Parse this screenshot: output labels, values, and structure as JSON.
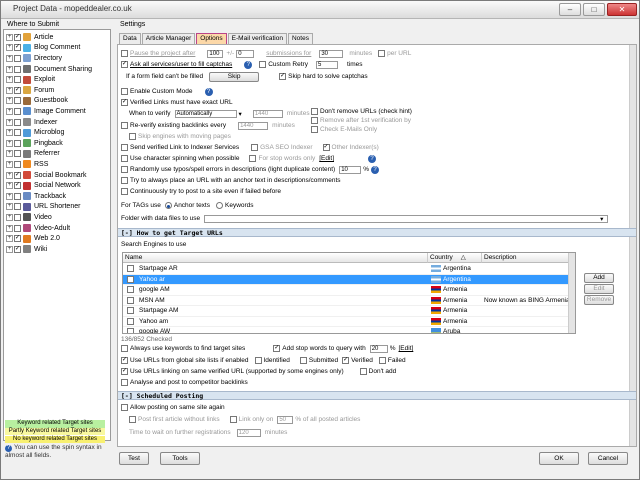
{
  "window": {
    "title": "Project Data - mopeddealer.co.uk"
  },
  "left": {
    "legend": "Where to Submit",
    "items": [
      {
        "label": "Article",
        "checked": true,
        "color": "#e2a23a",
        "sel": false
      },
      {
        "label": "Blog Comment",
        "checked": true,
        "color": "#4ab0e6",
        "sel": false
      },
      {
        "label": "Directory",
        "checked": false,
        "color": "#7c9fd0",
        "sel": false
      },
      {
        "label": "Document Sharing",
        "checked": false,
        "color": "#6f6f6f",
        "sel": false
      },
      {
        "label": "Exploit",
        "checked": false,
        "color": "#c24b3a",
        "sel": false
      },
      {
        "label": "Forum",
        "checked": true,
        "color": "#d9a640",
        "sel": false
      },
      {
        "label": "Guestbook",
        "checked": false,
        "color": "#9a6a3a",
        "sel": false
      },
      {
        "label": "Image Comment",
        "checked": false,
        "color": "#5a8fcf",
        "sel": false
      },
      {
        "label": "Indexer",
        "checked": false,
        "color": "#8a8a8a",
        "sel": false
      },
      {
        "label": "Microblog",
        "checked": false,
        "color": "#4f9bd9",
        "sel": false
      },
      {
        "label": "Pingback",
        "checked": false,
        "color": "#5ba35b",
        "sel": false
      },
      {
        "label": "Referrer",
        "checked": false,
        "color": "#7a7a7a",
        "sel": false
      },
      {
        "label": "RSS",
        "checked": false,
        "color": "#f08a20",
        "sel": false
      },
      {
        "label": "Social Bookmark",
        "checked": true,
        "color": "#d24a3a",
        "sel": false
      },
      {
        "label": "Social Network",
        "checked": true,
        "color": "#c23030",
        "sel": false
      },
      {
        "label": "Trackback",
        "checked": false,
        "color": "#6a8cc4",
        "sel": false
      },
      {
        "label": "URL Shortener",
        "checked": false,
        "color": "#5a5a9a",
        "sel": false
      },
      {
        "label": "Video",
        "checked": false,
        "color": "#555555",
        "sel": false
      },
      {
        "label": "Video-Adult",
        "checked": false,
        "color": "#b04a7a",
        "sel": false
      },
      {
        "label": "Web 2.0",
        "checked": true,
        "color": "#e07a20",
        "sel": false
      },
      {
        "label": "Wiki",
        "checked": true,
        "color": "#808080",
        "sel": false
      }
    ],
    "legend_keys": [
      {
        "label": "Keyword related Target sites",
        "color": "#b8f0a0"
      },
      {
        "label": "Partly Keyword related Target sites",
        "color": "#f8f8a0"
      },
      {
        "label": "No keyword related Target sites",
        "color": "#f8f070"
      }
    ],
    "hint": "You can use the spin syntax in almost all fields."
  },
  "settings": {
    "legend": "Settings",
    "tabs": [
      "Data",
      "Article Manager",
      "Options",
      "E-Mail verification",
      "Notes"
    ],
    "active_tab": 2,
    "pause_label": "Pause the project after",
    "pause_value": "100",
    "pm_label": "+/-",
    "pm_value": "0",
    "pause_unit": "submissions for",
    "minutes_value": "30",
    "minutes_label": "minutes",
    "per_url": "per URL",
    "ask_all": "Ask all services/user to fill captchas",
    "custom_retry": "Custom Retry",
    "retry_value": "5",
    "times": "times",
    "form_fail": "If a form field can't be filled",
    "skip_value": "Skip",
    "skip_hard": "Skip hard to solve captchas",
    "custom_mode": "Enable Custom Mode",
    "verified_links": "Verified Links must have exact URL",
    "when_verify": "When to verify",
    "verify_mode": "Automatically",
    "verify_min": "1440",
    "dont_remove": "Don't remove URLs (check hint)",
    "remove_after": "Remove after 1st verification by",
    "check_email": "Check E-Mails Only",
    "reverify": "Re-verify existing backlinks every",
    "reverify_min": "1440",
    "skip_moving": "Skip engines with moving pages",
    "send_verified": "Send verified Link to Indexer Services",
    "gsa_seo": "GSA SEO Indexer",
    "other_idx": "Other Indexer(s)",
    "char_spin": "Use character spinning when possible",
    "stop_words": "For stop words only",
    "edit": "[Edit]",
    "random_typos": "Randomly use typos/spell errors in descriptions (light duplicate content)",
    "typo_pct": "10",
    "pct": "%",
    "try_place": "Try to always place an URL with an anchor text in descriptions/comments",
    "continuously": "Continuously try to post to a site even if failed before",
    "tags_label": "For TAGs use",
    "anchor_texts": "Anchor texts",
    "keywords": "Keywords",
    "folder_label": "Folder with  data files to use",
    "sec1": "[-] How to get Target URLs",
    "search_label": "Search Engines to use",
    "cols": [
      "Name",
      "Country",
      "Description"
    ],
    "rows": [
      {
        "name": "Startpage AR",
        "country": "Argentina",
        "desc": "",
        "sel": false,
        "flag": "ar"
      },
      {
        "name": "Yahoo ar",
        "country": "Argentina",
        "desc": "",
        "sel": true,
        "flag": "ar"
      },
      {
        "name": "google AM",
        "country": "Armenia",
        "desc": "",
        "sel": false,
        "flag": "am"
      },
      {
        "name": "MSN AM",
        "country": "Armenia",
        "desc": "Now known as BING Armenia",
        "sel": false,
        "flag": "am"
      },
      {
        "name": "Startpage AM",
        "country": "Armenia",
        "desc": "",
        "sel": false,
        "flag": "am"
      },
      {
        "name": "Yahoo am",
        "country": "Armenia",
        "desc": "",
        "sel": false,
        "flag": "am"
      },
      {
        "name": "google AW",
        "country": "Aruba",
        "desc": "",
        "sel": false,
        "flag": "aw"
      }
    ],
    "side_btns": [
      "Add",
      "Edit",
      "Remove"
    ],
    "checked_count": "136/852 Checked",
    "always_kw": "Always use keywords to find target sites",
    "add_stop": "Add stop words to query with",
    "stop_pct": "20",
    "global_lists": "Use URLs from global site lists if enabled",
    "identified": "Identified",
    "submitted": "Submitted",
    "verified": "Verified",
    "failed": "Failed",
    "urls_linking": "Use URLs linking on same verified URL (supported by some engines only)",
    "dont_add": "Don't add",
    "analyse": "Analyse and post to competitor backlinks",
    "sec2": "[-] Scheduled Posting",
    "allow_same": "Allow posting on same site again",
    "post_first": "Post first article without links",
    "link_only": "Link only on",
    "link_pct": "50",
    "of_all": "% of all posted articles",
    "time_wait": "Time to wait on further registrations",
    "wait_value": "120",
    "minutes": "minutes"
  },
  "bottom": {
    "test": "Test",
    "tools": "Tools",
    "ok": "OK",
    "cancel": "Cancel"
  }
}
